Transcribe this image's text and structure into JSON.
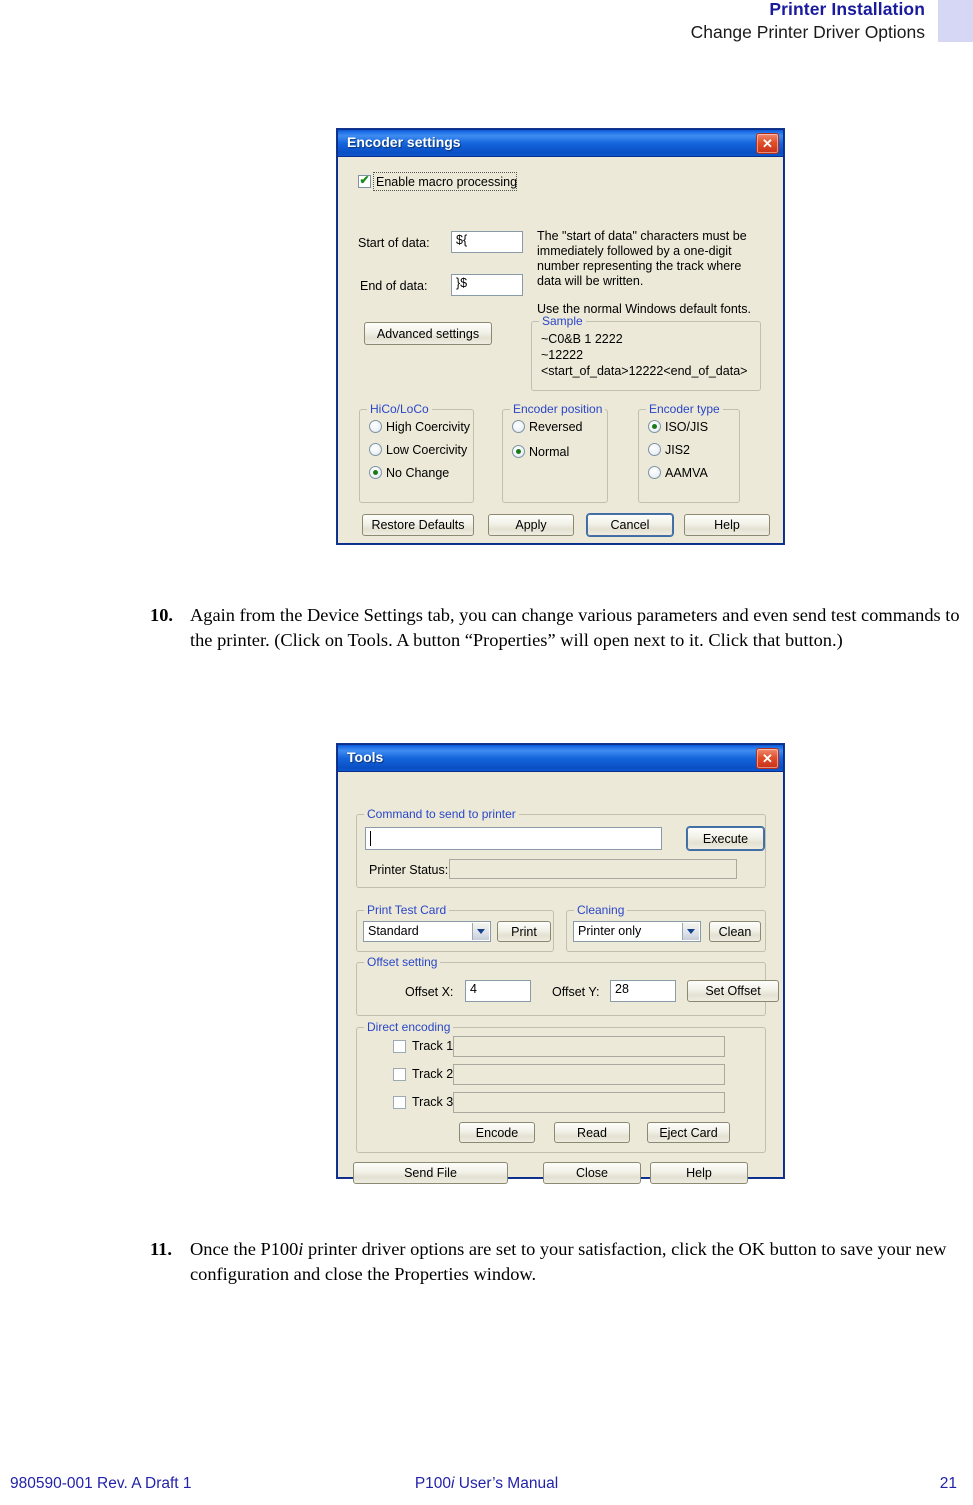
{
  "header": {
    "title": "Printer Installation",
    "subtitle": "Change Printer Driver Options"
  },
  "footer": {
    "left": "980590-001 Rev. A Draft 1",
    "center_pre": "P100",
    "center_italic": "i",
    "center_post": " User’s Manual",
    "page": "21"
  },
  "steps": [
    {
      "number": "10.",
      "text": "Again from the Device Settings tab, you can change various parameters and even send test commands to the printer. (Click on Tools. A button “Properties” will open next to it. Click that button.)"
    },
    {
      "number": "11.",
      "text_pre": "Once the P100",
      "text_italic": "i",
      "text_post": " printer driver options are set to your satisfaction, click the OK button to save your new configuration and close the Properties window."
    }
  ],
  "encoder_dialog": {
    "title": "Encoder settings",
    "close_icon": "close-icon",
    "enable_macro": {
      "label": "Enable macro processing",
      "checked": true
    },
    "start_of_data": {
      "label": "Start of data:",
      "value": "${"
    },
    "end_of_data": {
      "label": "End of data:",
      "value": "}$"
    },
    "description_lines": [
      "The \"start of data\" characters must be",
      "immediately followed by a one-digit",
      "number representing the track where",
      "data will be written."
    ],
    "fonts_note": "Use the normal Windows default fonts.",
    "advanced_button": "Advanced settings",
    "sample": {
      "legend": "Sample",
      "lines": [
        "~C0&B 1 2222",
        "~12222",
        "<start_of_data>12222<end_of_data>"
      ]
    },
    "hico_loco": {
      "legend": "HiCo/LoCo",
      "options": [
        {
          "label": "High Coercivity",
          "selected": false
        },
        {
          "label": "Low Coercivity",
          "selected": false
        },
        {
          "label": "No Change",
          "selected": true
        }
      ]
    },
    "encoder_position": {
      "legend": "Encoder position",
      "options": [
        {
          "label": "Reversed",
          "selected": false
        },
        {
          "label": "Normal",
          "selected": true
        }
      ]
    },
    "encoder_type": {
      "legend": "Encoder type",
      "options": [
        {
          "label": "ISO/JIS",
          "selected": true
        },
        {
          "label": "JIS2",
          "selected": false
        },
        {
          "label": "AAMVA",
          "selected": false
        }
      ]
    },
    "buttons": [
      {
        "label": "Restore Defaults",
        "focused": false
      },
      {
        "label": "Apply",
        "focused": false
      },
      {
        "label": "Cancel",
        "focused": true
      },
      {
        "label": "Help",
        "focused": false
      }
    ]
  },
  "tools_dialog": {
    "title": "Tools",
    "close_icon": "close-icon",
    "command_group": {
      "legend": "Command to send to printer",
      "value": "",
      "button": "Execute"
    },
    "printer_status": {
      "label": "Printer Status:",
      "value": ""
    },
    "print_test_card": {
      "legend": "Print Test Card",
      "selected": "Standard",
      "button": "Print"
    },
    "cleaning": {
      "legend": "Cleaning",
      "selected": "Printer only",
      "button": "Clean"
    },
    "offset_setting": {
      "legend": "Offset setting",
      "offset_x_label": "Offset X:",
      "offset_x_value": "4",
      "offset_y_label": "Offset Y:",
      "offset_y_value": "28",
      "button": "Set Offset"
    },
    "direct_encoding": {
      "legend": "Direct encoding",
      "tracks": [
        {
          "label": "Track 1",
          "checked": false,
          "value": ""
        },
        {
          "label": "Track 2",
          "checked": false,
          "value": ""
        },
        {
          "label": "Track 3",
          "checked": false,
          "value": ""
        }
      ],
      "buttons": [
        "Encode",
        "Read",
        "Eject Card"
      ]
    },
    "buttons": [
      {
        "label": "Send File"
      },
      {
        "label": "Close"
      },
      {
        "label": "Help"
      }
    ]
  }
}
